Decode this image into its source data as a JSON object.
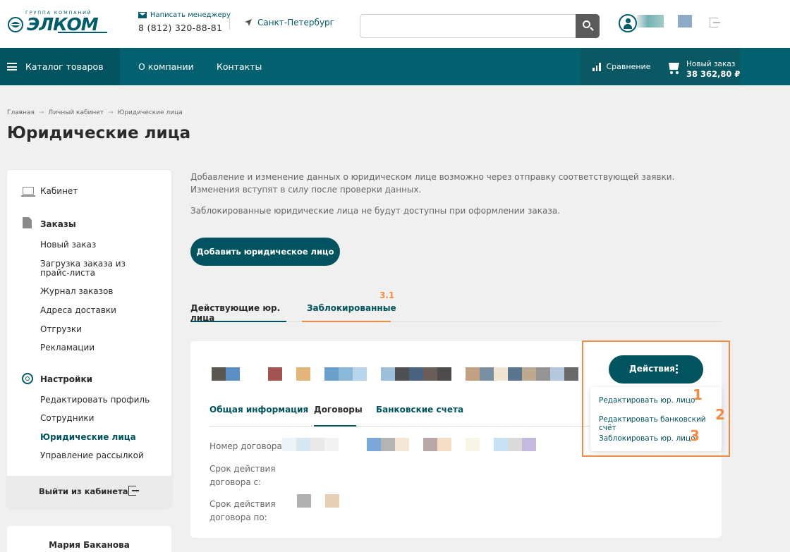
{
  "header": {
    "logo_small": "группа компаний",
    "logo_big": "ЭЛКОМ",
    "manager_link": "Написать менеджеру",
    "phone": "8 (812) 320-88-81",
    "city": "Санкт-Петербург",
    "search_placeholder": ""
  },
  "nav": {
    "catalog": "Каталог товаров",
    "about": "О компании",
    "contacts": "Контакты",
    "compare": "Сравнение",
    "cart_label": "Новый заказ",
    "cart_total": "38 362,80 ₽"
  },
  "breadcrumb": [
    "Главная",
    "Личный кабинет",
    "Юридические лица"
  ],
  "breadcrumb_sep": "→",
  "page_title": "Юридические лица",
  "sidebar": {
    "cabinet": "Кабинет",
    "orders_head": "Заказы",
    "orders_items": [
      "Новый заказ",
      "Загрузка заказа из прайс-листа",
      "Журнал заказов",
      "Адреса доставки",
      "Отгрузки",
      "Рекламации"
    ],
    "settings_head": "Настройки",
    "settings_items": [
      "Редактировать профиль",
      "Сотрудники",
      "Юридические лица",
      "Управление рассылкой"
    ],
    "exit": "Выйти из кабинета",
    "manager_name": "Мария Баканова"
  },
  "main": {
    "intro1": "Добавление и изменение данных о юридическом лице возможно через отправку соответствующей заявки. Изменения вступят в силу после проверки данных.",
    "intro2": "Заблокированные юридические лица не будут доступны при оформлении заказа.",
    "add_button": "Добавить юридическое лицо",
    "tabs": [
      "Действующие юр. лица",
      "Заблокированные"
    ],
    "tab_marker": "3.1"
  },
  "card": {
    "actions_button": "Действия",
    "inner_tabs": [
      "Общая информация",
      "Договоры",
      "Банковские счета"
    ],
    "field_contract_number": "Номер договора:",
    "field_valid_from": "Срок действия договора с:",
    "field_valid_to": "Срок действия договора по:"
  },
  "dropdown": {
    "items": [
      "Редактировать юр. лицо",
      "Редактировать банковский счёт",
      "Заблокировать юр. лицо"
    ],
    "markers": [
      "1",
      "2",
      "3"
    ]
  },
  "colors": {
    "brand": "#005b6a",
    "nav": "#03616f",
    "accent": "#f08c46"
  }
}
